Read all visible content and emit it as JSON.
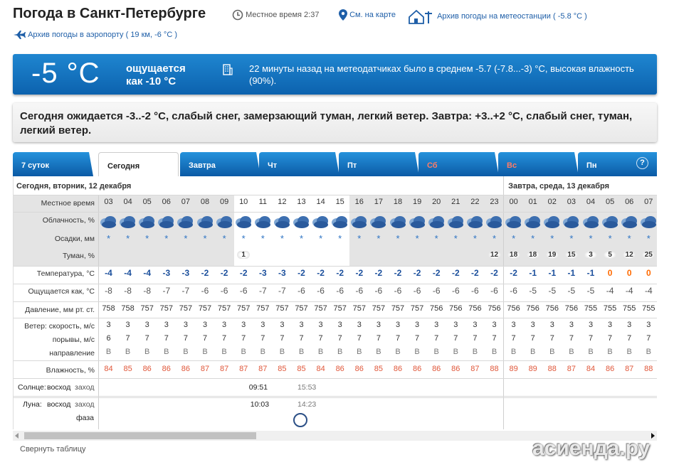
{
  "header": {
    "title": "Погода в Санкт-Петербурге",
    "local_time_label": "Местное время",
    "local_time": "2:37",
    "map_link": "См. на карте",
    "station_archive": "Архив погоды на метеостанции",
    "station_temp": "( -5.8 °C )",
    "airport_archive": "Архив погоды в аэропорту",
    "airport_info": "( 19 км, -6 °C )"
  },
  "current": {
    "temp": "-5 °C",
    "feels_line1": "ощущается",
    "feels_line2": "как -10 °C",
    "sensor_text": "22 минуты назад на метеодатчиках было в среднем -5.7 (-7.8...-3) °C, высокая влажность (90%)."
  },
  "forecast_text": "Сегодня ожидается -3..-2 °C, слабый снег, замерзающий туман, легкий ветер. Завтра: +3..+2 °C, слабый снег, туман, легкий ветер.",
  "tabs": [
    {
      "label": "7 суток"
    },
    {
      "label": "Сегодня"
    },
    {
      "label": "Завтра"
    },
    {
      "label": "Чт"
    },
    {
      "label": "Пт"
    },
    {
      "label": "Сб"
    },
    {
      "label": "Вс"
    },
    {
      "label": "Пн"
    }
  ],
  "help_label": "?",
  "days": {
    "today": "Сегодня, вторник, 12 декабря",
    "tomorrow": "Завтра, среда, 13 декабря"
  },
  "labels": {
    "time": "Местное время",
    "clouds": "Облачность, %",
    "precip": "Осадки, мм",
    "fog": "Туман, %",
    "temp": "Температура, °С",
    "feels": "Ощущается как, °С",
    "pressure": "Давление, мм рт. ст.",
    "wind": "Ветер: скорость, м/с",
    "gusts": "порывы, м/с",
    "direction": "направление",
    "humidity": "Влажность, %",
    "sun_a": "Солнце:",
    "sun_b": "восход",
    "sun_c": "заход",
    "moon_a": "Луна:",
    "moon_b": "восход",
    "moon_c": "заход",
    "phase": "фаза"
  },
  "hours": [
    "03",
    "04",
    "05",
    "06",
    "07",
    "08",
    "09",
    "10",
    "11",
    "12",
    "13",
    "14",
    "15",
    "16",
    "17",
    "18",
    "19",
    "20",
    "21",
    "22",
    "23",
    "00",
    "01",
    "02",
    "03",
    "04",
    "05",
    "06",
    "07"
  ],
  "fog": [
    "",
    "",
    "",
    "",
    "",
    "",
    "",
    "1",
    "",
    "",
    "",
    "",
    "",
    "",
    "",
    "",
    "",
    "",
    "",
    "",
    "12",
    "18",
    "18",
    "19",
    "15",
    "3",
    "5",
    "12",
    "25"
  ],
  "temps": [
    "-4",
    "-4",
    "-4",
    "-3",
    "-3",
    "-2",
    "-2",
    "-2",
    "-3",
    "-3",
    "-2",
    "-2",
    "-2",
    "-2",
    "-2",
    "-2",
    "-2",
    "-2",
    "-2",
    "-2",
    "-2",
    "-2",
    "-1",
    "-1",
    "-1",
    "-1",
    "0",
    "0",
    "0"
  ],
  "feels": [
    "-8",
    "-8",
    "-8",
    "-7",
    "-7",
    "-6",
    "-6",
    "-6",
    "-7",
    "-7",
    "-6",
    "-6",
    "-6",
    "-6",
    "-6",
    "-6",
    "-6",
    "-6",
    "-6",
    "-6",
    "-6",
    "-6",
    "-5",
    "-5",
    "-5",
    "-5",
    "-4",
    "-4",
    "-4"
  ],
  "pressure": [
    "758",
    "758",
    "757",
    "757",
    "757",
    "757",
    "757",
    "757",
    "757",
    "757",
    "757",
    "757",
    "757",
    "757",
    "757",
    "757",
    "757",
    "756",
    "756",
    "756",
    "756",
    "756",
    "756",
    "756",
    "756",
    "755",
    "755",
    "755",
    "755"
  ],
  "wind": [
    "3",
    "3",
    "3",
    "3",
    "3",
    "3",
    "3",
    "3",
    "3",
    "3",
    "3",
    "3",
    "3",
    "3",
    "3",
    "3",
    "3",
    "3",
    "3",
    "3",
    "3",
    "3",
    "3",
    "3",
    "3",
    "3",
    "3",
    "3",
    "3"
  ],
  "gusts": [
    "6",
    "7",
    "7",
    "7",
    "7",
    "7",
    "7",
    "7",
    "7",
    "7",
    "7",
    "7",
    "7",
    "7",
    "7",
    "7",
    "7",
    "7",
    "7",
    "7",
    "7",
    "7",
    "7",
    "7",
    "7",
    "7",
    "7",
    "7",
    "7"
  ],
  "direction": [
    "В",
    "В",
    "В",
    "В",
    "В",
    "В",
    "В",
    "В",
    "В",
    "В",
    "В",
    "В",
    "В",
    "В",
    "В",
    "В",
    "В",
    "В",
    "В",
    "В",
    "В",
    "В",
    "В",
    "В",
    "В",
    "В",
    "В",
    "В",
    "В"
  ],
  "humidity": [
    "84",
    "85",
    "86",
    "86",
    "86",
    "87",
    "87",
    "87",
    "87",
    "85",
    "85",
    "84",
    "86",
    "86",
    "85",
    "86",
    "86",
    "86",
    "86",
    "87",
    "88",
    "89",
    "89",
    "88",
    "87",
    "84",
    "86",
    "87",
    "88"
  ],
  "sun": {
    "rise": "09:51",
    "set": "15:53"
  },
  "moon": {
    "rise": "10:03",
    "set": "14:23"
  },
  "collapse_label": "Свернуть таблицу",
  "watermark": "асиенда.ру",
  "colors": {
    "banner": "#1278c4",
    "tab": "#1a7ccc",
    "cold": "#1b4f9c",
    "warm": "#ff6a00",
    "humidity": "#e0573a"
  }
}
